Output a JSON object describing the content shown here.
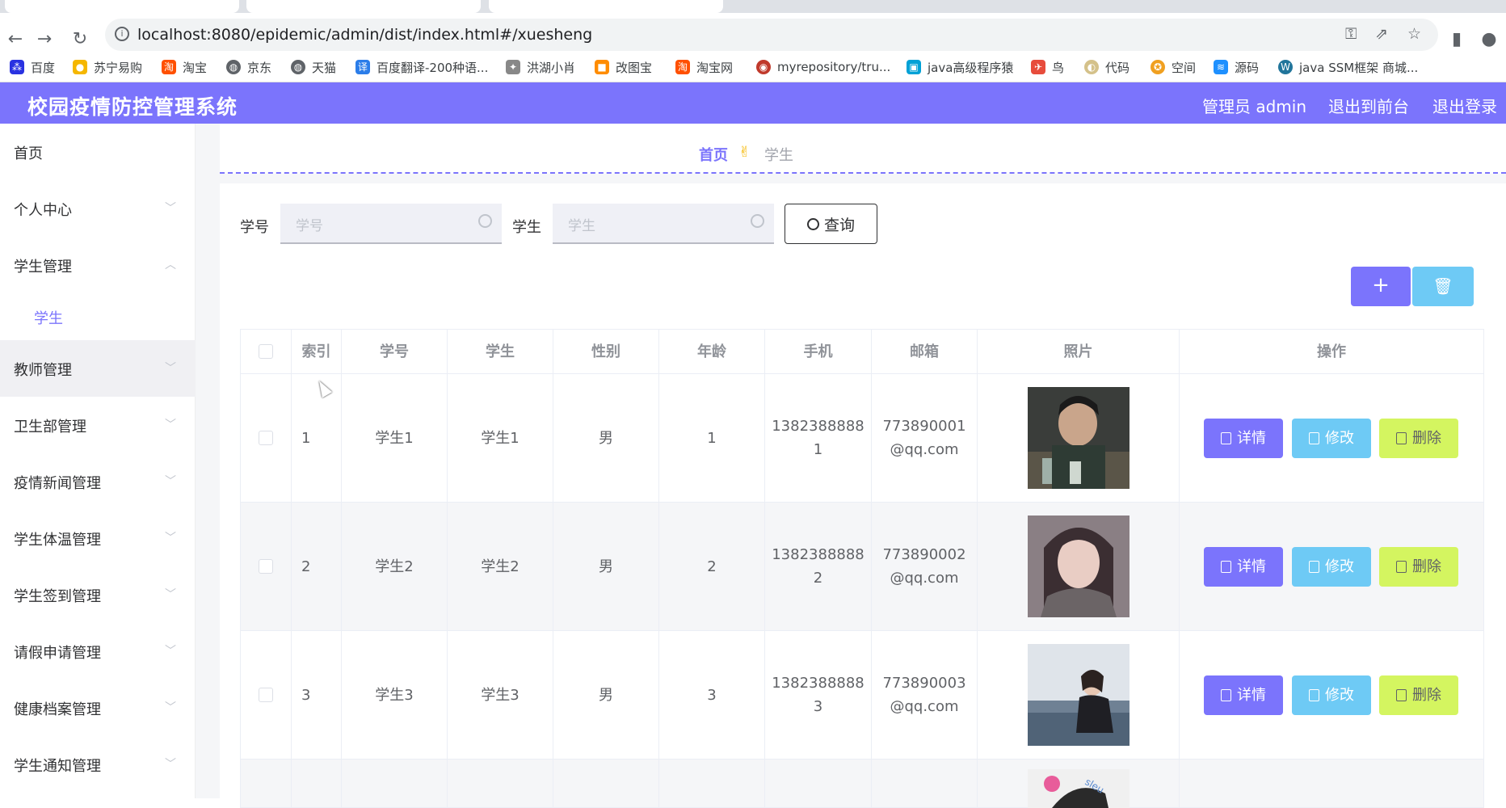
{
  "browser": {
    "url": "localhost:8080/epidemic/admin/dist/index.html#/xuesheng",
    "bookmarks": [
      "百度",
      "苏宁易购",
      "淘宝",
      "京东",
      "天猫",
      "百度翻译-200种语...",
      "洪湖小肖",
      "改图宝",
      "淘宝网",
      "myrepository/tru...",
      "java高级程序猿",
      "鸟",
      "代码",
      "空间",
      "源码",
      "java SSM框架 商城..."
    ]
  },
  "header": {
    "title": "校园疫情防控管理系统",
    "admin": "管理员 admin",
    "to_front": "退出到前台",
    "logout": "退出登录"
  },
  "sidebar": {
    "items": [
      "首页",
      "个人中心",
      "学生管理",
      "学生",
      "教师管理",
      "卫生部管理",
      "疫情新闻管理",
      "学生体温管理",
      "学生签到管理",
      "请假申请管理",
      "健康档案管理",
      "学生通知管理"
    ]
  },
  "breadcrumb": {
    "home": "首页",
    "current": "学生"
  },
  "search": {
    "label1": "学号",
    "placeholder1": "学号",
    "label2": "学生",
    "placeholder2": "学生",
    "query": "查询"
  },
  "toolbar": {
    "add": "+",
    "delete": "🗑"
  },
  "table": {
    "headers": [
      "索引",
      "学号",
      "学生",
      "性别",
      "年龄",
      "手机",
      "邮箱",
      "照片",
      "操作"
    ],
    "rows": [
      {
        "index": "1",
        "xuehao": "学生1",
        "xuesheng": "学生1",
        "gender": "男",
        "age": "1",
        "phone1": "1382388888",
        "phone2": "1",
        "email1": "773890001",
        "email2": "@qq.com"
      },
      {
        "index": "2",
        "xuehao": "学生2",
        "xuesheng": "学生2",
        "gender": "男",
        "age": "2",
        "phone1": "1382388888",
        "phone2": "2",
        "email1": "773890002",
        "email2": "@qq.com"
      },
      {
        "index": "3",
        "xuehao": "学生3",
        "xuesheng": "学生3",
        "gender": "男",
        "age": "3",
        "phone1": "1382388888",
        "phone2": "3",
        "email1": "773890003",
        "email2": "@qq.com"
      }
    ],
    "actions": {
      "detail": "详情",
      "edit": "修改",
      "delete": "删除"
    }
  },
  "colors": {
    "accent": "#7b74fc",
    "info": "#6ecaf5",
    "warn": "#d4f560"
  }
}
